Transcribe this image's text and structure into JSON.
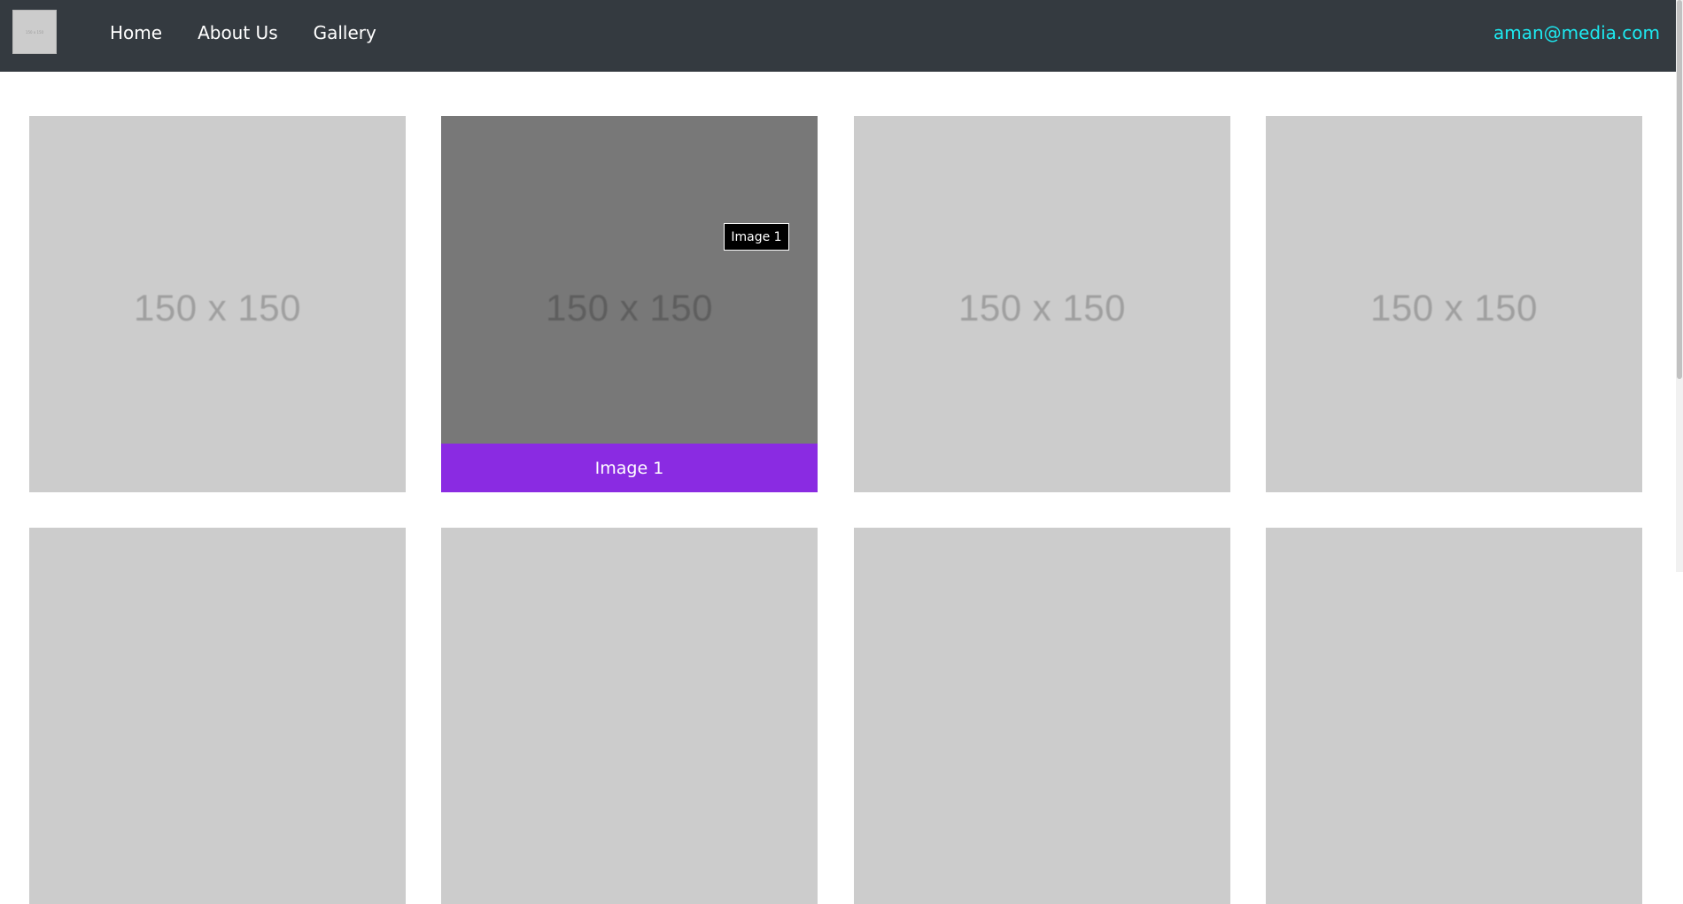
{
  "logo": {
    "text": "150 x 150"
  },
  "nav": {
    "links": [
      "Home",
      "About Us",
      "Gallery"
    ],
    "email": "aman@media.com"
  },
  "gallery": {
    "tile_text": "150 x 150",
    "hovered_caption": "Image 1",
    "tooltip": "Image 1"
  },
  "colors": {
    "navbar_bg": "#343a40",
    "email": "#1de9f0",
    "caption_bg": "#8a2be2",
    "placeholder_bg": "#cccccc"
  }
}
